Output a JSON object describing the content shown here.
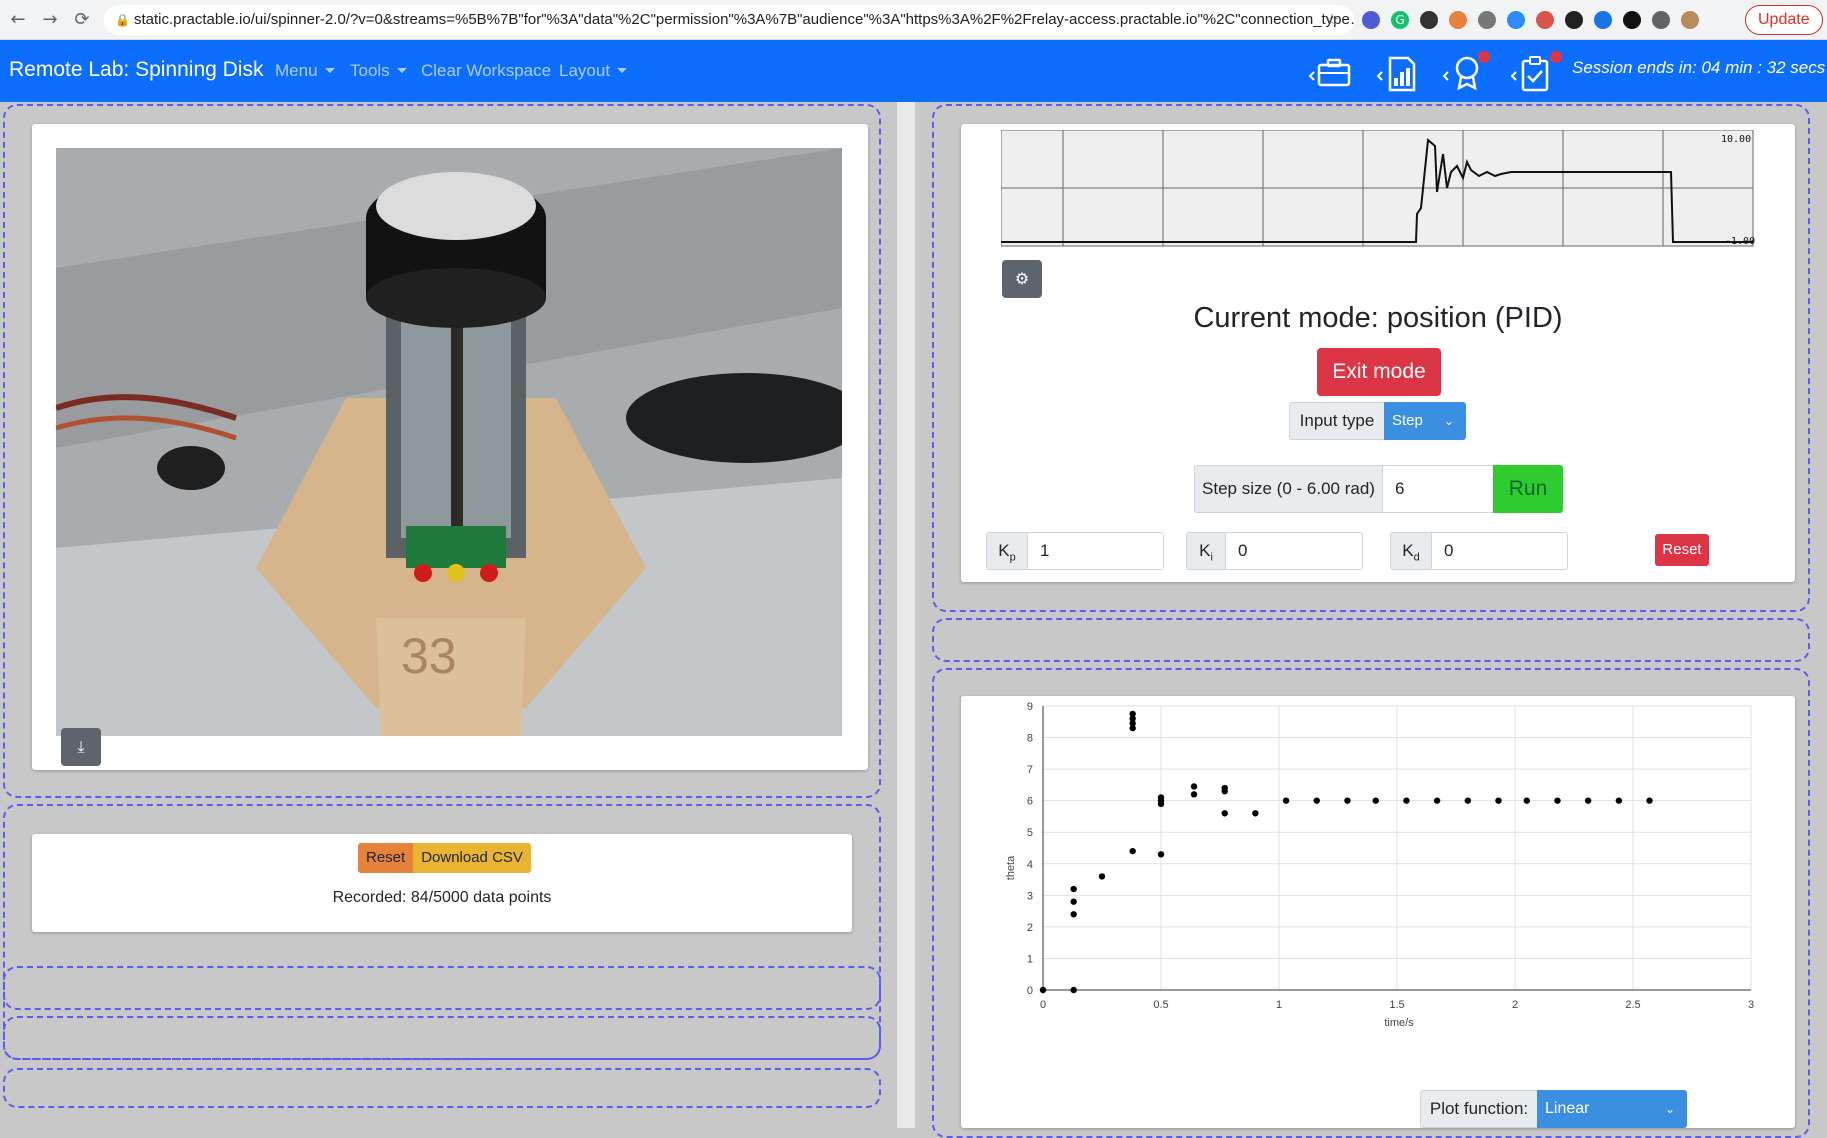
{
  "browser": {
    "url": "static.practable.io/ui/spinner-2.0/?v=0&streams=%5B%7B\"for\"%3A\"data\"%2C\"permission\"%3A%7B\"audience\"%3A\"https%3A%2F%2Frelay-access.practable.io\"%2C\"connection_type…",
    "update_label": "Update"
  },
  "navbar": {
    "brand": "Remote Lab: Spinning Disk",
    "menu_label": "Menu",
    "tools_label": "Tools",
    "clear_label": "Clear Workspace",
    "layout_label": "Layout",
    "session_text": "Session ends in: 04 min : 32 secs"
  },
  "recorder": {
    "reset_label": "Reset",
    "download_label": "Download CSV",
    "status_text": "Recorded: 84/5000 data points"
  },
  "mini_graph": {
    "y_max_label": "10.00",
    "y_min_label": "-1.00"
  },
  "controls": {
    "mode_title": "Current mode: position (PID)",
    "exit_label": "Exit mode",
    "input_type_label": "Input type",
    "input_type_value": "Step",
    "step_size_label": "Step size (0 - 6.00 rad)",
    "step_size_value": "6",
    "run_label": "Run",
    "kp_label": "Kp",
    "kp_value": "1",
    "ki_label": "Ki",
    "ki_value": "0",
    "kd_label": "Kd",
    "kd_value": "0",
    "gain_reset_label": "Reset"
  },
  "plot": {
    "plot_function_label": "Plot function:",
    "plot_function_value": "Linear"
  },
  "colors": {
    "navbar": "#0d6efd",
    "exit": "#dc3545",
    "run": "#2ecc2e",
    "select": "#3b8fe0",
    "reset_orange": "#e8823a",
    "download_yellow": "#e9b530"
  },
  "chart_data": {
    "type": "scatter",
    "title": "",
    "xlabel": "time/s",
    "ylabel": "theta",
    "xlim": [
      0,
      3
    ],
    "ylim": [
      0,
      9
    ],
    "x_ticks": [
      "0",
      "0.5",
      "1",
      "1.5",
      "2",
      "2.5",
      "3"
    ],
    "y_ticks": [
      "0",
      "1",
      "2",
      "3",
      "4",
      "5",
      "6",
      "7",
      "8",
      "9"
    ],
    "grid": true,
    "points": [
      [
        0,
        0
      ],
      [
        0.13,
        0
      ],
      [
        0.13,
        2.4
      ],
      [
        0.13,
        2.8
      ],
      [
        0.13,
        3.2
      ],
      [
        0.25,
        3.6
      ],
      [
        0.38,
        4.4
      ],
      [
        0.38,
        8.3
      ],
      [
        0.38,
        8.45
      ],
      [
        0.38,
        8.6
      ],
      [
        0.38,
        8.75
      ],
      [
        0.5,
        4.3
      ],
      [
        0.5,
        5.9
      ],
      [
        0.5,
        6.0
      ],
      [
        0.5,
        6.1
      ],
      [
        0.64,
        6.2
      ],
      [
        0.64,
        6.45
      ],
      [
        0.77,
        5.6
      ],
      [
        0.77,
        6.3
      ],
      [
        0.77,
        6.4
      ],
      [
        0.9,
        5.6
      ],
      [
        1.03,
        6.0
      ],
      [
        1.16,
        6.0
      ],
      [
        1.29,
        6.0
      ],
      [
        1.41,
        6.0
      ],
      [
        1.54,
        6.0
      ],
      [
        1.67,
        6.0
      ],
      [
        1.8,
        6.0
      ],
      [
        1.93,
        6.0
      ],
      [
        2.05,
        6.0
      ],
      [
        2.18,
        6.0
      ],
      [
        2.31,
        6.0
      ],
      [
        2.44,
        6.0
      ],
      [
        2.57,
        6.0
      ]
    ]
  }
}
